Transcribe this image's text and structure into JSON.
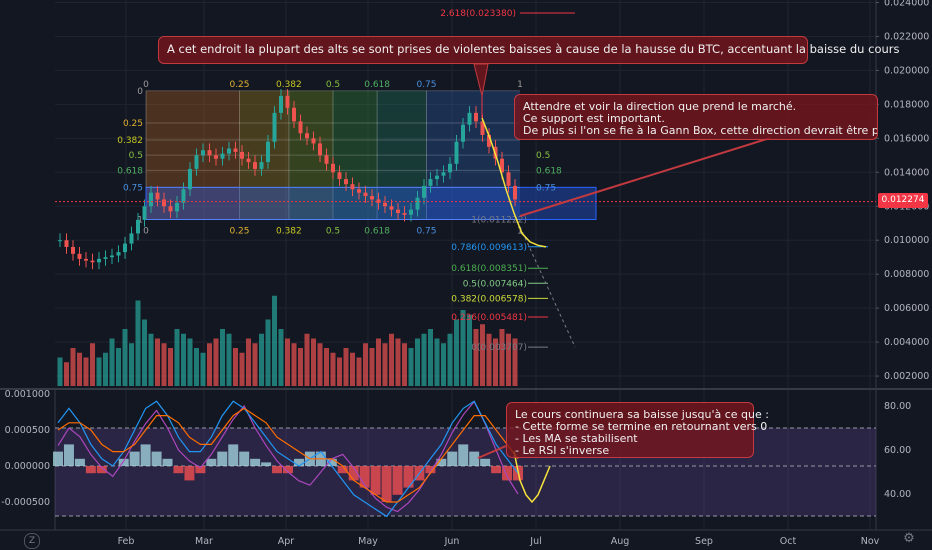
{
  "chart_data": [
    {
      "type": "candlestick",
      "y_axis_ticks": [
        "0.024000",
        "0.022000",
        "0.020000",
        "0.018000",
        "0.016000",
        "0.014000",
        "0.012000",
        "0.010000",
        "0.008000",
        "0.006000",
        "0.004000",
        "0.002000"
      ],
      "y_axis_values": [
        0.024,
        0.022,
        0.02,
        0.018,
        0.016,
        0.014,
        0.012,
        0.01,
        0.008,
        0.006,
        0.004,
        0.002
      ],
      "ylim": [
        0.0,
        0.0245
      ],
      "x_axis_ticks": [
        "Feb",
        "Mar",
        "Apr",
        "May",
        "Jun",
        "Jul",
        "Aug",
        "Sep",
        "Oct",
        "Nov"
      ],
      "current_price": "0.012274",
      "current_price_value": 0.012274,
      "fib_extension_levels": [
        {
          "label": "2.618(0.023380)",
          "value": 0.02338,
          "color": "#f23645"
        },
        {
          "label": "1(0.011222)",
          "value": 0.011222,
          "color": "#787b86"
        },
        {
          "label": "0.786(0.009613)",
          "value": 0.009613,
          "color": "#2196f3"
        },
        {
          "label": "0.618(0.008351)",
          "value": 0.008351,
          "color": "#4caf50"
        },
        {
          "label": "0.5(0.007464)",
          "value": 0.007464,
          "color": "#81c784"
        },
        {
          "label": "0.382(0.006578)",
          "value": 0.006578,
          "color": "#cddc39"
        },
        {
          "label": "0.236(0.005481)",
          "value": 0.005481,
          "color": "#f23645"
        },
        {
          "label": "0(0.003707)",
          "value": 0.003707,
          "color": "#787b86"
        }
      ],
      "gann_box": {
        "top_value": 0.0188,
        "bottom_value": 0.01122,
        "time_labels": [
          "0",
          "0.25",
          "0.382",
          "0.5",
          "0.618",
          "0.75",
          "1"
        ],
        "price_labels": [
          "0",
          "0.25",
          "0.382",
          "0.5",
          "0.618",
          "0.75",
          "1"
        ],
        "price_fracs": [
          0,
          0.25,
          0.382,
          0.5,
          0.618,
          0.75,
          1
        ],
        "time_fracs": [
          0,
          0.25,
          0.382,
          0.5,
          0.618,
          0.75,
          1
        ]
      },
      "right_price_labels": [
        "0.382",
        "0.5",
        "0.618"
      ],
      "close_series": [
        0.01,
        0.0096,
        0.0092,
        0.0089,
        0.0088,
        0.0087,
        0.0089,
        0.009,
        0.0091,
        0.0093,
        0.0098,
        0.0104,
        0.0112,
        0.012,
        0.0128,
        0.0124,
        0.012,
        0.0117,
        0.0122,
        0.013,
        0.0142,
        0.015,
        0.0153,
        0.015,
        0.0148,
        0.0151,
        0.0154,
        0.0152,
        0.0148,
        0.0146,
        0.0142,
        0.0146,
        0.0158,
        0.0175,
        0.0185,
        0.0178,
        0.017,
        0.0163,
        0.016,
        0.0157,
        0.015,
        0.0145,
        0.014,
        0.0136,
        0.0133,
        0.013,
        0.0128,
        0.0126,
        0.0124,
        0.0122,
        0.012,
        0.0118,
        0.0116,
        0.0115,
        0.0118,
        0.0125,
        0.0132,
        0.0136,
        0.0138,
        0.014,
        0.0145,
        0.0158,
        0.0168,
        0.0175,
        0.017,
        0.0162,
        0.0155,
        0.0148,
        0.014,
        0.0132,
        0.0124
      ],
      "projection": [
        0.0172,
        0.016,
        0.0146,
        0.013,
        0.0116,
        0.0104,
        0.0099,
        0.0097,
        0.00961
      ],
      "volume": [
        0.3,
        0.25,
        0.4,
        0.35,
        0.3,
        0.45,
        0.3,
        0.35,
        0.5,
        0.4,
        0.6,
        0.45,
        0.9,
        0.7,
        0.55,
        0.5,
        0.45,
        0.4,
        0.6,
        0.55,
        0.5,
        0.4,
        0.35,
        0.45,
        0.5,
        0.6,
        0.55,
        0.4,
        0.35,
        0.5,
        0.45,
        0.55,
        0.7,
        0.95,
        0.6,
        0.5,
        0.45,
        0.4,
        0.55,
        0.5,
        0.45,
        0.4,
        0.35,
        0.3,
        0.4,
        0.35,
        0.3,
        0.45,
        0.4,
        0.5,
        0.45,
        0.55,
        0.5,
        0.45,
        0.4,
        0.5,
        0.55,
        0.6,
        0.5,
        0.45,
        0.55,
        0.7,
        0.8,
        0.75,
        0.6,
        0.65,
        0.55,
        0.5,
        0.6,
        0.55,
        0.5
      ]
    },
    {
      "type": "line",
      "name": "oscillator",
      "left_axis_ticks": [
        "0.001000",
        "0.000500",
        "0.000000",
        "-0.000500"
      ],
      "left_axis_values": [
        0.001,
        0.0005,
        0.0,
        -0.0005
      ],
      "right_axis_ticks": [
        "80.00",
        "60.00",
        "40.00"
      ],
      "right_axis_values": [
        80,
        60,
        40
      ],
      "rsi_band": [
        70,
        30
      ],
      "histogram": [
        0.0002,
        0.0003,
        0.0001,
        -0.0001,
        -0.0001,
        0.0,
        0.0001,
        0.0002,
        0.0003,
        0.0002,
        0.0001,
        -0.0001,
        -0.0002,
        -0.0001,
        0.0001,
        0.0002,
        0.0003,
        0.0002,
        0.0001,
        5e-05,
        -0.0001,
        -0.0001,
        0.0001,
        0.0002,
        0.0002,
        0.0001,
        -0.0001,
        -0.0002,
        -0.0003,
        -0.0004,
        -0.0005,
        -0.0004,
        -0.0003,
        -0.0002,
        -0.0001,
        0.0001,
        0.0002,
        0.0003,
        0.0002,
        0.0001,
        -0.0001,
        -0.0002,
        -0.0002
      ],
      "rsi": [
        62,
        70,
        66,
        58,
        52,
        48,
        55,
        64,
        72,
        78,
        70,
        60,
        55,
        52,
        58,
        66,
        74,
        80,
        70,
        62,
        55,
        50,
        46,
        44,
        50,
        56,
        58,
        52,
        44,
        38,
        34,
        32,
        36,
        42,
        50,
        58,
        68,
        76,
        82,
        72,
        60,
        48,
        40
      ],
      "macd": [
        0.0006,
        0.0008,
        0.0006,
        0.0003,
        0.0001,
        0.0,
        0.0002,
        0.0005,
        0.0008,
        0.0009,
        0.0007,
        0.0004,
        0.0002,
        0.0002,
        0.0004,
        0.0007,
        0.0009,
        0.0008,
        0.0006,
        0.0004,
        0.0002,
        0.0001,
        0.0,
        0.0001,
        0.0002,
        0.0,
        -0.0002,
        -0.0004,
        -0.0005,
        -0.0006,
        -0.0007,
        -0.0005,
        -0.0003,
        -0.0001,
        0.0001,
        0.0003,
        0.0006,
        0.0008,
        0.0009,
        0.0006,
        0.0003,
        0.0001,
        -0.0001
      ],
      "signal": [
        0.0005,
        0.0006,
        0.0006,
        0.0005,
        0.0003,
        0.0002,
        0.0002,
        0.0003,
        0.0005,
        0.0007,
        0.0007,
        0.0006,
        0.0004,
        0.0003,
        0.0003,
        0.0005,
        0.0007,
        0.0008,
        0.0007,
        0.0006,
        0.0004,
        0.0003,
        0.0002,
        0.0001,
        0.0001,
        0.0001,
        0.0,
        -0.0002,
        -0.0003,
        -0.0004,
        -0.0005,
        -0.0005,
        -0.0004,
        -0.0003,
        -0.0001,
        0.0001,
        0.0003,
        0.0005,
        0.0007,
        0.0007,
        0.0005,
        0.0003,
        0.0001
      ],
      "projection": [
        0.0002,
        -0.0002,
        -0.0004,
        -0.0005,
        -0.0004,
        -0.0002,
        0.0
      ]
    }
  ],
  "annotations": {
    "note1": "A cet endroit la plupart des alts se sont prises de violentes baisses à cause de la hausse du BTC, accentuant la baisse du cours",
    "note2_lines": [
      "Attendre et voir la direction que prend le marché.",
      "Ce support est important.",
      "De plus si l'on se fie à la Gann Box, cette direction devrait être prise dans"
    ],
    "note3_lines": [
      "Le cours continuera sa baisse jusqu'à ce que :",
      "- Cette forme se termine en retournant vers 0",
      "- Les MA se stabilisent",
      "- Le RSI s'inverse"
    ]
  },
  "colors": {
    "background": "#131722",
    "up": "#26a69a",
    "down": "#ef5350",
    "note_bg": "#78141c",
    "projection": "#f5e33b"
  },
  "icons": {
    "bottom_left": "Z",
    "bottom_right": "⚙"
  }
}
